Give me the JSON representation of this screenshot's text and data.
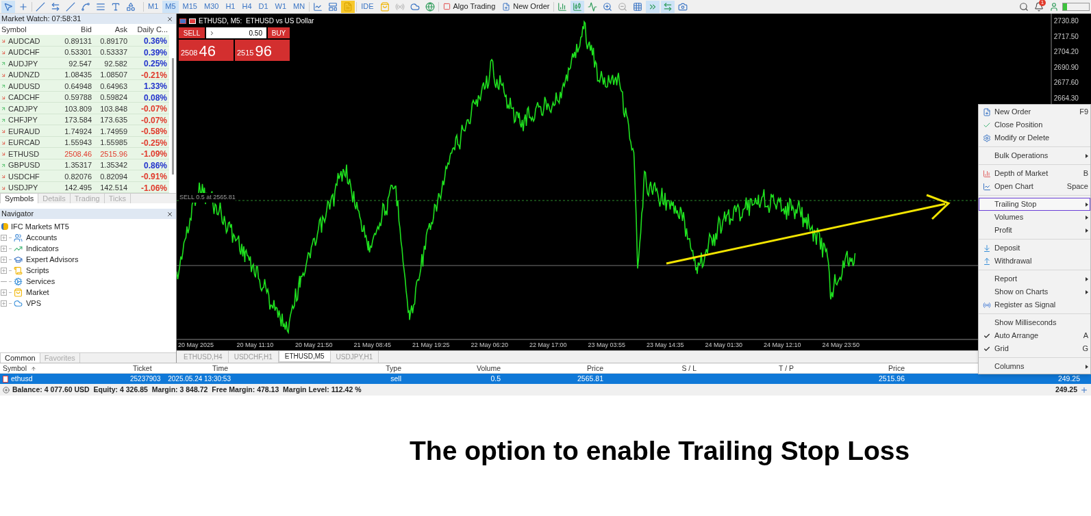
{
  "toolbar": {
    "timeframes": [
      {
        "label": "M1",
        "selected": false
      },
      {
        "label": "M5",
        "selected": true
      },
      {
        "label": "M15",
        "selected": false
      },
      {
        "label": "M30",
        "selected": false
      },
      {
        "label": "H1",
        "selected": false
      },
      {
        "label": "H4",
        "selected": false
      },
      {
        "label": "D1",
        "selected": false
      },
      {
        "label": "W1",
        "selected": false
      },
      {
        "label": "MN",
        "selected": false
      }
    ],
    "ide": "IDE",
    "algo_trading": "Algo Trading",
    "new_order": "New Order",
    "notification_count": "1"
  },
  "market_watch": {
    "title": "Market Watch: 07:58:31",
    "columns": [
      "Symbol",
      "Bid",
      "Ask",
      "Daily C..."
    ],
    "rows": [
      {
        "symbol": "AUDCAD",
        "bid": "0.89131",
        "ask": "0.89170",
        "change": "0.36%",
        "rising": false,
        "color": "#2233cc",
        "alert": false
      },
      {
        "symbol": "AUDCHF",
        "bid": "0.53301",
        "ask": "0.53337",
        "change": "0.39%",
        "rising": false,
        "color": "#2233cc",
        "alert": false
      },
      {
        "symbol": "AUDJPY",
        "bid": "92.547",
        "ask": "92.582",
        "change": "0.25%",
        "rising": true,
        "color": "#2233cc",
        "alert": false
      },
      {
        "symbol": "AUDNZD",
        "bid": "1.08435",
        "ask": "1.08507",
        "change": "-0.21%",
        "rising": false,
        "color": "#e0392b",
        "alert": false
      },
      {
        "symbol": "AUDUSD",
        "bid": "0.64948",
        "ask": "0.64963",
        "change": "1.33%",
        "rising": true,
        "color": "#2233cc",
        "alert": false
      },
      {
        "symbol": "CADCHF",
        "bid": "0.59788",
        "ask": "0.59824",
        "change": "0.08%",
        "rising": false,
        "color": "#2233cc",
        "alert": false
      },
      {
        "symbol": "CADJPY",
        "bid": "103.809",
        "ask": "103.848",
        "change": "-0.07%",
        "rising": true,
        "color": "#e0392b",
        "alert": false
      },
      {
        "symbol": "CHFJPY",
        "bid": "173.584",
        "ask": "173.635",
        "change": "-0.07%",
        "rising": true,
        "color": "#e0392b",
        "alert": false
      },
      {
        "symbol": "EURAUD",
        "bid": "1.74924",
        "ask": "1.74959",
        "change": "-0.58%",
        "rising": false,
        "color": "#e0392b",
        "alert": false
      },
      {
        "symbol": "EURCAD",
        "bid": "1.55943",
        "ask": "1.55985",
        "change": "-0.25%",
        "rising": false,
        "color": "#e0392b",
        "alert": false
      },
      {
        "symbol": "ETHUSD",
        "bid": "2508.46",
        "ask": "2515.96",
        "change": "-1.09%",
        "rising": false,
        "color": "#e0392b",
        "alert": true
      },
      {
        "symbol": "GBPUSD",
        "bid": "1.35317",
        "ask": "1.35342",
        "change": "0.86%",
        "rising": true,
        "color": "#2233cc",
        "alert": false
      },
      {
        "symbol": "USDCHF",
        "bid": "0.82076",
        "ask": "0.82094",
        "change": "-0.91%",
        "rising": false,
        "color": "#e0392b",
        "alert": false
      },
      {
        "symbol": "USDJPY",
        "bid": "142.495",
        "ask": "142.514",
        "change": "-1.06%",
        "rising": false,
        "color": "#e0392b",
        "alert": false
      }
    ],
    "tabs": [
      {
        "label": "Symbols",
        "selected": true
      },
      {
        "label": "Details",
        "selected": false
      },
      {
        "label": "Trading",
        "selected": false
      },
      {
        "label": "Ticks",
        "selected": false
      }
    ]
  },
  "navigator": {
    "title": "Navigator",
    "root": "IFC Markets MT5",
    "children": [
      {
        "label": "Accounts",
        "expandable": true
      },
      {
        "label": "Indicators",
        "expandable": true
      },
      {
        "label": "Expert Advisors",
        "expandable": true
      },
      {
        "label": "Scripts",
        "expandable": true
      },
      {
        "label": "Services",
        "expandable": false
      },
      {
        "label": "Market",
        "expandable": true
      },
      {
        "label": "VPS",
        "expandable": true
      }
    ],
    "tabs": [
      {
        "label": "Common",
        "selected": true
      },
      {
        "label": "Favorites",
        "selected": false
      }
    ]
  },
  "chart": {
    "title": "ETHUSD, M5:  ETHUSD vs US Dollar",
    "one_click": {
      "sell": "SELL",
      "lot": "0.50",
      "buy": "BUY",
      "sell_price_small": "2508",
      "sell_price_big": "46",
      "buy_price_small": "2515",
      "buy_price_big": "96"
    },
    "order_line_label": "SELL 0.5 at 2565.81",
    "price_axis": [
      "2730.80",
      "2717.50",
      "2704.20",
      "2690.90",
      "2677.60",
      "2664.30"
    ],
    "time_axis": [
      "20 May 2025",
      "20 May 11:10",
      "20 May 21:50",
      "21 May 08:45",
      "21 May 19:25",
      "22 May 06:20",
      "22 May 17:00",
      "23 May 03:55",
      "23 May 14:35",
      "24 May 01:30",
      "24 May 12:10",
      "24 May 23:50"
    ],
    "tabs": [
      {
        "label": "ETHUSD,H4",
        "selected": false
      },
      {
        "label": "USDCHF,H1",
        "selected": false
      },
      {
        "label": "ETHUSD,M5",
        "selected": true
      },
      {
        "label": "USDJPY,H1",
        "selected": false
      }
    ]
  },
  "context_menu": {
    "sections": [
      [
        {
          "label": "New Order",
          "shortcut": "F9",
          "submenu": false,
          "checked": false,
          "selected": false
        },
        {
          "label": "Close Position",
          "submenu": false,
          "checked": false,
          "selected": false
        },
        {
          "label": "Modify or Delete",
          "submenu": false,
          "checked": false,
          "selected": false
        }
      ],
      [
        {
          "label": "Bulk Operations",
          "submenu": true,
          "checked": false,
          "selected": false
        }
      ],
      [
        {
          "label": "Depth of Market",
          "shortcut": "B",
          "submenu": false,
          "checked": false,
          "selected": false
        },
        {
          "label": "Open Chart",
          "shortcut": "Space",
          "submenu": false,
          "checked": false,
          "selected": false
        }
      ],
      [
        {
          "label": "Trailing Stop",
          "submenu": true,
          "checked": false,
          "selected": true
        },
        {
          "label": "Volumes",
          "submenu": true,
          "checked": false,
          "selected": false
        },
        {
          "label": "Profit",
          "submenu": true,
          "checked": false,
          "selected": false
        }
      ],
      [
        {
          "label": "Deposit",
          "submenu": false,
          "checked": false,
          "selected": false
        },
        {
          "label": "Withdrawal",
          "submenu": false,
          "checked": false,
          "selected": false
        }
      ],
      [
        {
          "label": "Report",
          "submenu": true,
          "checked": false,
          "selected": false
        },
        {
          "label": "Show on Charts",
          "submenu": true,
          "checked": false,
          "selected": false
        },
        {
          "label": "Register as Signal",
          "submenu": false,
          "checked": false,
          "selected": false
        }
      ],
      [
        {
          "label": "Show Milliseconds",
          "submenu": false,
          "checked": false,
          "selected": false
        },
        {
          "label": "Auto Arrange",
          "shortcut": "A",
          "submenu": false,
          "checked": true,
          "selected": false
        },
        {
          "label": "Grid",
          "shortcut": "G",
          "submenu": false,
          "checked": true,
          "selected": false
        }
      ],
      [
        {
          "label": "Columns",
          "submenu": true,
          "checked": false,
          "selected": false
        }
      ]
    ]
  },
  "terminal": {
    "columns": [
      {
        "label": "Symbol",
        "sorted": true
      },
      {
        "label": "Ticket",
        "sorted": false
      },
      {
        "label": "Time",
        "sorted": false
      },
      {
        "label": "Type",
        "sorted": false
      },
      {
        "label": "Volume",
        "sorted": false
      },
      {
        "label": "Price",
        "sorted": false
      },
      {
        "label": "S / L",
        "sorted": false
      },
      {
        "label": "T / P",
        "sorted": false
      },
      {
        "label": "Price",
        "sorted": false
      }
    ],
    "rows": [
      {
        "symbol": "ethusd",
        "ticket": "25237903",
        "time": "2025.05.24 13:30:53",
        "type": "sell",
        "volume": "0.5",
        "open_price": "2565.81",
        "current_price": "2515.96",
        "profit": "249.25",
        "selected": true
      }
    ],
    "summary": "Balance: 4 077.60 USD  Equity: 4 326.85  Margin: 3 848.72  Free Margin: 478.13  Margin Level: 112.42 %",
    "total": "249.25"
  },
  "caption": "The option to enable Trailing Stop Loss"
}
